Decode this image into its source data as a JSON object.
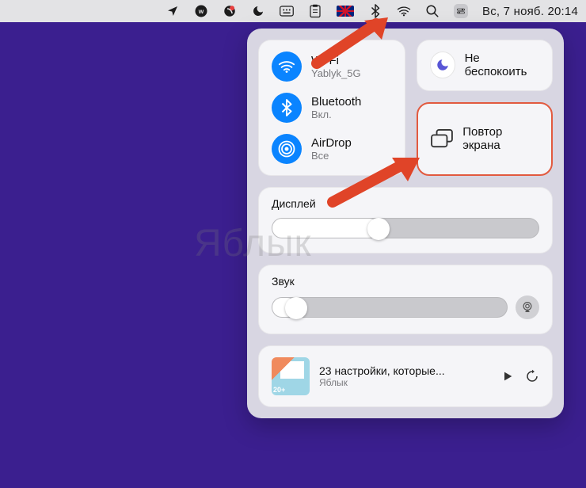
{
  "menubar": {
    "datetime": "Вс, 7 нояб.  20:14"
  },
  "controlCenter": {
    "wifi": {
      "title": "Wi-Fi",
      "sub": "Yablyk_5G"
    },
    "bluetooth": {
      "title": "Bluetooth",
      "sub": "Вкл."
    },
    "airdrop": {
      "title": "AirDrop",
      "sub": "Все"
    },
    "dnd": {
      "label": "Не беспокоить"
    },
    "screenMirroring": {
      "label": "Повтор экрана"
    },
    "display": {
      "label": "Дисплей",
      "value": 40
    },
    "sound": {
      "label": "Звук",
      "value": 10
    },
    "nowPlaying": {
      "title": "23 настройки, которые...",
      "sub": "Яблык"
    }
  },
  "watermark": "Яблык"
}
